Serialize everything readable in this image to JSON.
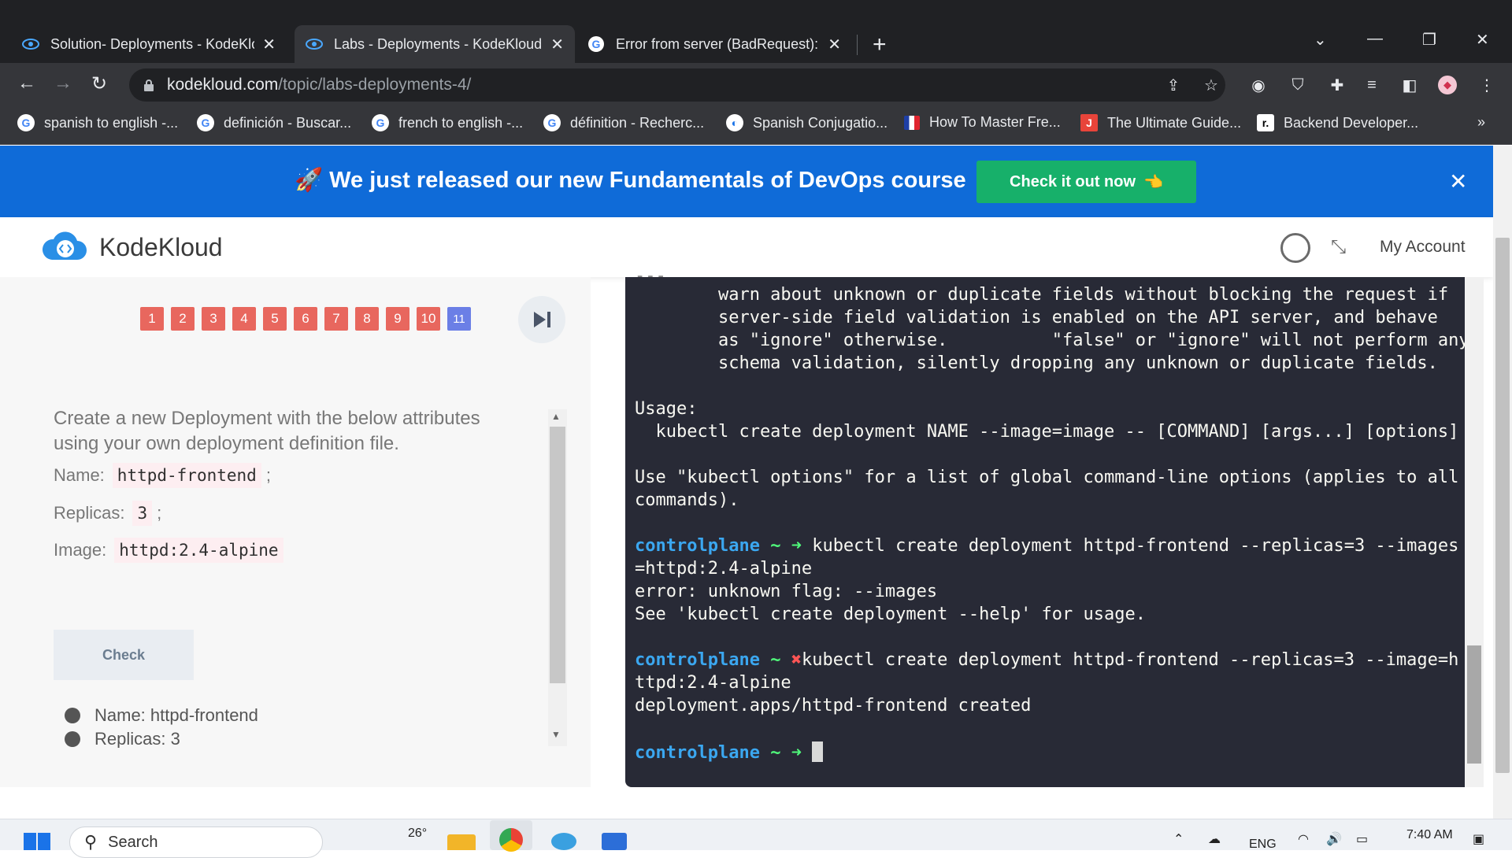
{
  "browser": {
    "tabs": [
      {
        "title": "Solution- Deployments - KodeKloud",
        "active": false,
        "icon": "kodekloud-icon"
      },
      {
        "title": "Labs - Deployments - KodeKloud",
        "active": true,
        "icon": "kodekloud-icon"
      },
      {
        "title": "Error from server (BadRequest): e",
        "active": false,
        "icon": "google-icon"
      }
    ],
    "new_tab": "+",
    "url_host": "kodekloud.com",
    "url_path": "/topic/labs-deployments-4/",
    "bookmarks": [
      {
        "label": "spanish to english -...",
        "icon": "google-icon"
      },
      {
        "label": "definición - Buscar...",
        "icon": "google-icon"
      },
      {
        "label": "french to english -...",
        "icon": "google-icon"
      },
      {
        "label": "définition - Recherc...",
        "icon": "google-icon"
      },
      {
        "label": "Spanish Conjugatio...",
        "icon": "spanishdict-icon"
      },
      {
        "label": "How To Master Fre...",
        "icon": "french-flag-icon"
      },
      {
        "label": "The Ultimate Guide...",
        "icon": "j-icon"
      },
      {
        "label": "Backend Developer...",
        "icon": "r-icon"
      }
    ],
    "more_bookmarks": "»"
  },
  "banner": {
    "text": "We just released our new Fundamentals of DevOps course",
    "button": "Check it out now",
    "close": "✕"
  },
  "header": {
    "brand": "KodeKloud",
    "account": "My Account"
  },
  "lab": {
    "questions": [
      "1",
      "2",
      "3",
      "4",
      "5",
      "6",
      "7",
      "8",
      "9",
      "10",
      "11"
    ],
    "current_question": "11",
    "task": "Create a new Deployment with the below attributes using your own deployment definition file.",
    "attributes": [
      {
        "label": "Name:",
        "value": "httpd-frontend",
        "suffix": ";"
      },
      {
        "label": "Replicas:",
        "value": "3",
        "suffix": ";"
      },
      {
        "label": "Image:",
        "value": "httpd:2.4-alpine",
        "suffix": ""
      }
    ],
    "check_button": "Check",
    "criteria": [
      "Name: httpd-frontend",
      "Replicas: 3"
    ]
  },
  "terminal": {
    "top_partial": "---",
    "help_lines": [
      "        warn about unknown or duplicate fields without blocking the request if",
      "        server-side field validation is enabled on the API server, and behave",
      "        as \"ignore\" otherwise.          \"false\" or \"ignore\" will not perform any",
      "        schema validation, silently dropping any unknown or duplicate fields."
    ],
    "usage_label": "Usage:",
    "usage_line": "  kubectl create deployment NAME --image=image -- [COMMAND] [args...] [options]",
    "options_line1": "Use \"kubectl options\" for a list of global command-line options (applies to all",
    "options_line2": "commands).",
    "prompt": "controlplane",
    "tilde": "~",
    "cmd1_a": " kubectl create deployment httpd-frontend --replicas=3 --images",
    "cmd1_b": "=httpd:2.4-alpine",
    "err1": "error: unknown flag: --images",
    "err2": "See 'kubectl create deployment --help' for usage.",
    "cmd2_a": "kubectl create deployment httpd-frontend --replicas=3 --image=h",
    "cmd2_b": "ttpd:2.4-alpine",
    "result": "deployment.apps/httpd-frontend created"
  },
  "taskbar": {
    "search_placeholder": "Search",
    "weather": "26°",
    "lang": "ENG",
    "time": "7:40 AM"
  },
  "colors": {
    "banner": "#0f6bd8",
    "cta": "#17b06a",
    "question_pending": "#e8675e",
    "question_current": "#6b7fe6",
    "terminal_bg": "#282a36",
    "prompt": "#3ba7f0",
    "arrow": "#50fa7b",
    "error_x": "#ff5555"
  }
}
